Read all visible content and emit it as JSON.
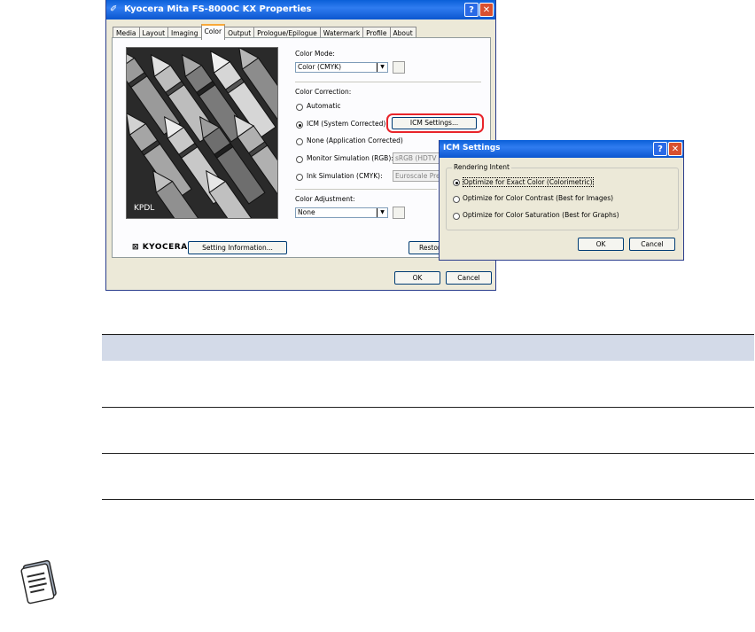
{
  "main_dialog": {
    "title": "Kyocera Mita FS-8000C KX Properties",
    "help_btn": "?",
    "close_btn": "✕",
    "tabs": [
      {
        "label": "Media"
      },
      {
        "label": "Layout"
      },
      {
        "label": "Imaging"
      },
      {
        "label": "Color"
      },
      {
        "label": "Output"
      },
      {
        "label": "Prologue/Epilogue"
      },
      {
        "label": "Watermark"
      },
      {
        "label": "Profile"
      },
      {
        "label": "About"
      }
    ],
    "preview_label": "KPDL",
    "color_mode": {
      "label": "Color Mode:",
      "value": "Color (CMYK)"
    },
    "color_correction": {
      "label": "Color Correction:",
      "options": [
        {
          "label": "Automatic",
          "selected": false
        },
        {
          "label": "ICM (System Corrected)",
          "selected": true
        },
        {
          "label": "None (Application Corrected)",
          "selected": false
        },
        {
          "label": "Monitor Simulation (RGB):",
          "selected": false,
          "field": "sRGB (HDTV"
        },
        {
          "label": "Ink Simulation (CMYK):",
          "selected": false,
          "field": "Euroscale Pre"
        }
      ],
      "icm_settings_btn": "ICM Settings..."
    },
    "color_adjustment": {
      "label": "Color Adjustment:",
      "value": "None"
    },
    "logo": "KYOCERA",
    "setting_info_btn": "Setting Information...",
    "restore_btn": "Restor",
    "ok_btn": "OK",
    "cancel_btn": "Cancel"
  },
  "icm_dialog": {
    "title": "ICM Settings",
    "help_btn": "?",
    "close_btn": "✕",
    "group_title": "Rendering Intent",
    "options": [
      {
        "label": "Optimize for Exact Color (Colorimetric)",
        "selected": true
      },
      {
        "label": "Optimize for Color Contrast (Best for Images)",
        "selected": false
      },
      {
        "label": "Optimize for Color Saturation (Best for Graphs)",
        "selected": false
      }
    ],
    "ok_btn": "OK",
    "cancel_btn": "Cancel"
  },
  "colors": {
    "title_bar": "#0a5fd8",
    "highlight_ring": "#e8242a",
    "table_header": "#d3dae8"
  },
  "icons": {
    "note": "note-memo-icon",
    "printer": "printer-icon"
  }
}
